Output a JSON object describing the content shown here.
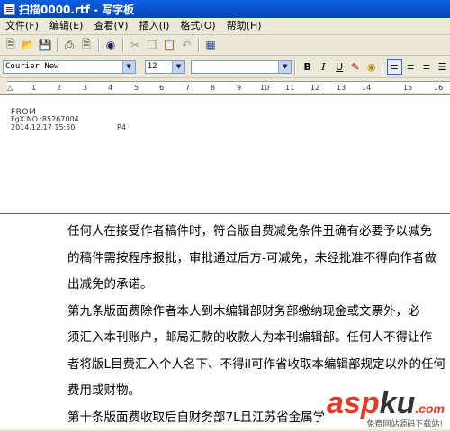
{
  "window": {
    "title": "扫描0000.rtf - 写字板"
  },
  "menu": [
    "文件(F)",
    "编辑(E)",
    "查看(V)",
    "插入(I)",
    "格式(O)",
    "帮助(H)"
  ],
  "toolbar_icons": [
    "new-icon",
    "open-icon",
    "save-icon",
    "print-icon",
    "print-preview-icon",
    "find-icon",
    "cut-icon",
    "copy-icon",
    "paste-icon",
    "undo-icon",
    "date-time-icon"
  ],
  "format": {
    "font": "Courier New",
    "size": "12",
    "script": "",
    "bold": "B",
    "italic": "I",
    "underline": "U"
  },
  "ruler": {
    "marks": [
      "1",
      "2",
      "3",
      "4",
      "5",
      "6",
      "7",
      "8",
      "9",
      "10",
      "11",
      "12",
      "13",
      "14",
      "15",
      "16"
    ]
  },
  "document": {
    "header": {
      "from": "FROM",
      "fax": "FgX NO.:85267004",
      "datetime": "2014.12.17 15:50",
      "page": "P4"
    },
    "lines": [
      "任何人在接受作者稿件时，符合版自费减免条件丑确有必要予以减免",
      "的稿件需按程序报批，审批通过后方-可减免，未经批准不得向作者做",
      "出减免的承诺。",
      "第九条版面费除作者本人到木编辑部财务部缴纳现金或文票外，必",
      "须汇入本刊账户，邮局汇款的收款人为本刊编辑部。任何人不得让作",
      "者将版L目费汇入个人名下、不得il可作省收取本编辑部规定以外的任何",
      "费用或财物。",
      "第十条版面费收取后自财务部7L且江苏省金属学"
    ]
  },
  "watermark": {
    "main_a": "asp",
    "main_b": "ku",
    "main_c": ".com",
    "sub": "免费网站源码下载站!"
  }
}
